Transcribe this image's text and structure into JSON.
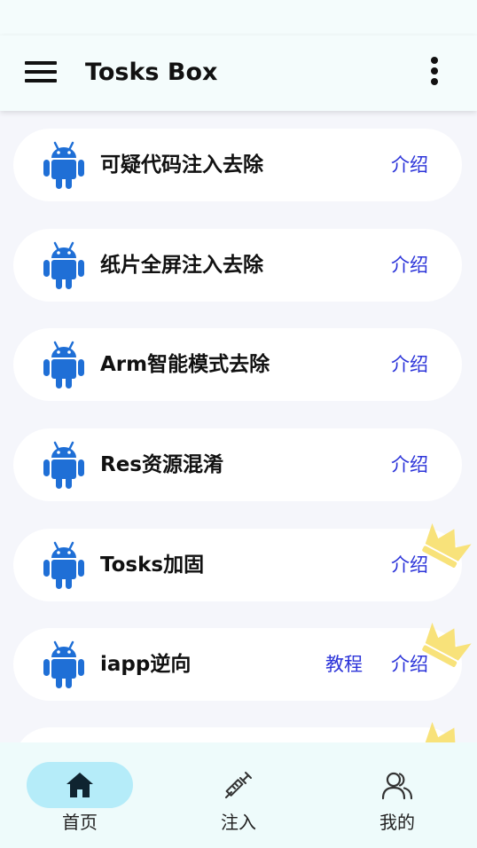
{
  "app": {
    "title": "Tosks Box",
    "colors": {
      "android_icon": "#1f6fd6",
      "link": "#2c34d9",
      "crown": "#f8e27a",
      "active_nav_pill": "#b5ecf9",
      "appbar_bg": "#f4fcfc"
    }
  },
  "header": {
    "menu_icon": "hamburger-menu-icon",
    "more_icon": "more-vertical-icon"
  },
  "list": {
    "items": [
      {
        "label": "可疑代码注入去除",
        "intro": "介绍",
        "icon": "android-icon"
      },
      {
        "label": "纸片全屏注入去除",
        "intro": "介绍",
        "icon": "android-icon"
      },
      {
        "label": "Arm智能模式去除",
        "intro": "介绍",
        "icon": "android-icon"
      },
      {
        "label": "Res资源混淆",
        "intro": "介绍",
        "icon": "android-icon"
      },
      {
        "label": "Tosks加固",
        "intro": "介绍",
        "icon": "android-icon",
        "badge": "crown-icon"
      },
      {
        "label": "iapp逆向",
        "tutorial": "教程",
        "intro": "介绍",
        "icon": "android-icon",
        "badge": "crown-icon"
      }
    ]
  },
  "bottom_nav": {
    "items": [
      {
        "label": "首页",
        "icon": "home-icon",
        "active": true
      },
      {
        "label": "注入",
        "icon": "syringe-icon",
        "active": false
      },
      {
        "label": "我的",
        "icon": "users-icon",
        "active": false
      }
    ]
  }
}
